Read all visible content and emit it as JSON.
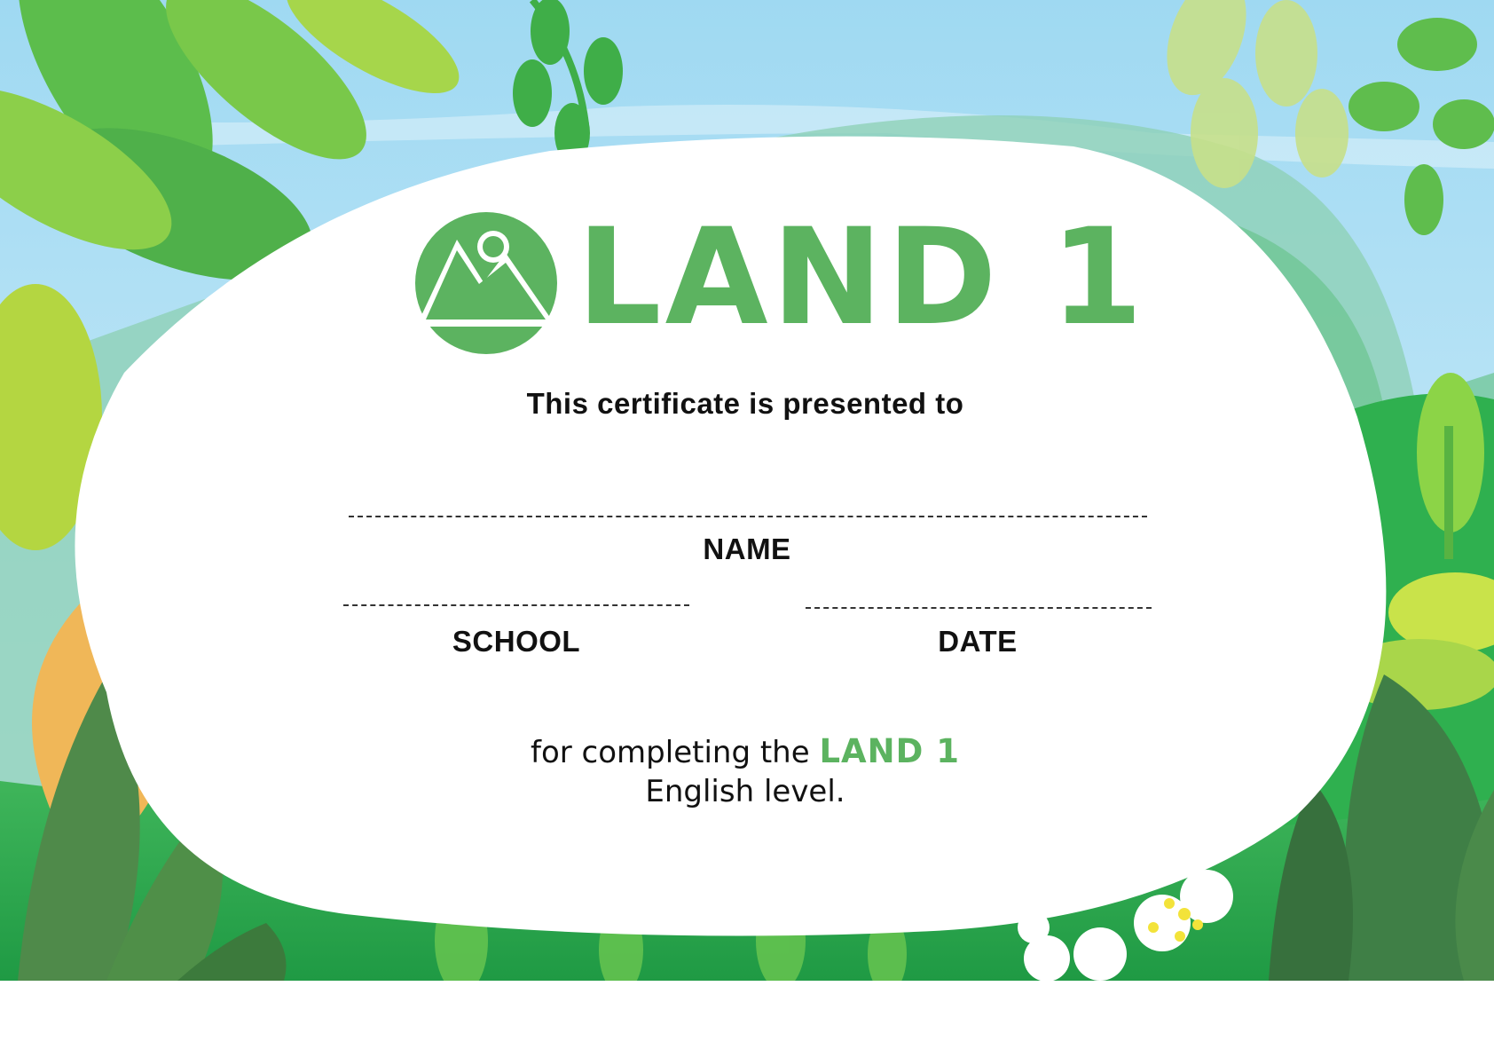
{
  "certificate": {
    "logo_title": "LAND 1",
    "presented_to": "This certificate is presented to",
    "name_label": "NAME",
    "school_label": "SCHOOL",
    "date_label": "DATE",
    "completion_prefix": "for completing the",
    "completion_level": "LAND 1",
    "completion_suffix": "English level."
  },
  "colors": {
    "brand_green": "#5cb360",
    "sky": "#a9ddf2",
    "text": "#111111"
  },
  "icons": {
    "logo": "mountain-sun-icon"
  }
}
